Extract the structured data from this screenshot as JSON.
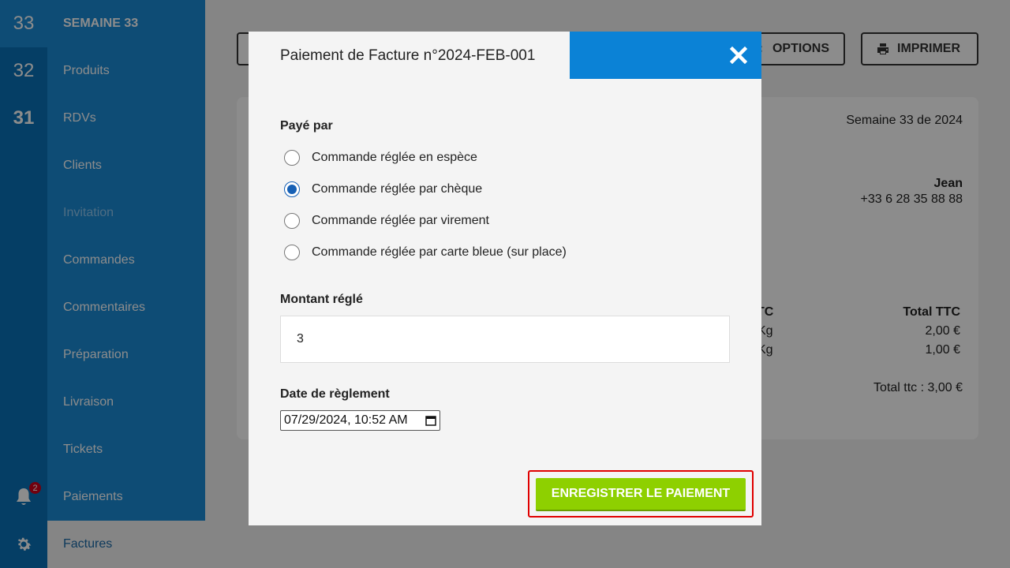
{
  "weeks": [
    {
      "label": "33"
    },
    {
      "label": "32"
    },
    {
      "label": "31"
    }
  ],
  "notifications": {
    "count": "2"
  },
  "sidebar": {
    "title": "SEMAINE 33",
    "items": [
      {
        "label": "Produits"
      },
      {
        "label": "RDVs"
      },
      {
        "label": "Clients"
      },
      {
        "label": "Invitation"
      },
      {
        "label": "Commandes"
      },
      {
        "label": "Commentaires"
      },
      {
        "label": "Préparation"
      },
      {
        "label": "Livraison"
      },
      {
        "label": "Tickets"
      },
      {
        "label": "Paiements"
      }
    ],
    "active_item": "Factures"
  },
  "toolbar": {
    "options_label": "OPTIONS",
    "print_label": "IMPRIMER"
  },
  "invoice": {
    "week_text": "Semaine 33 de 2024",
    "customer_name": "Jean",
    "customer_phone": "+33 6 28 35 88 88",
    "col_unit_partial": "TC",
    "col_total": "Total TTC",
    "rows": [
      {
        "unit_partial": "Kg",
        "total": "2,00 €"
      },
      {
        "unit_partial": "Kg",
        "total": "1,00 €"
      }
    ],
    "grand_total": "Total ttc : 3,00 €"
  },
  "modal": {
    "title": "Paiement de Facture n°2024-FEB-001",
    "paid_by_label": "Payé par",
    "options": [
      {
        "label": "Commande réglée en espèce",
        "checked": false
      },
      {
        "label": "Commande réglée par chèque",
        "checked": true
      },
      {
        "label": "Commande réglée par virement",
        "checked": false
      },
      {
        "label": "Commande réglée par carte bleue (sur place)",
        "checked": false
      }
    ],
    "amount_label": "Montant réglé",
    "amount_value": "3",
    "date_label": "Date de règlement",
    "date_value": "07/29/2024, 10:52 AM",
    "submit_label": "ENREGISTRER LE PAIEMENT"
  },
  "colors": {
    "brand_blue": "#1a8ad6",
    "header_blue": "#0b82d6",
    "submit_green": "#8ed000",
    "highlight_red": "#e00000",
    "radio_selected": "#1660b5"
  }
}
